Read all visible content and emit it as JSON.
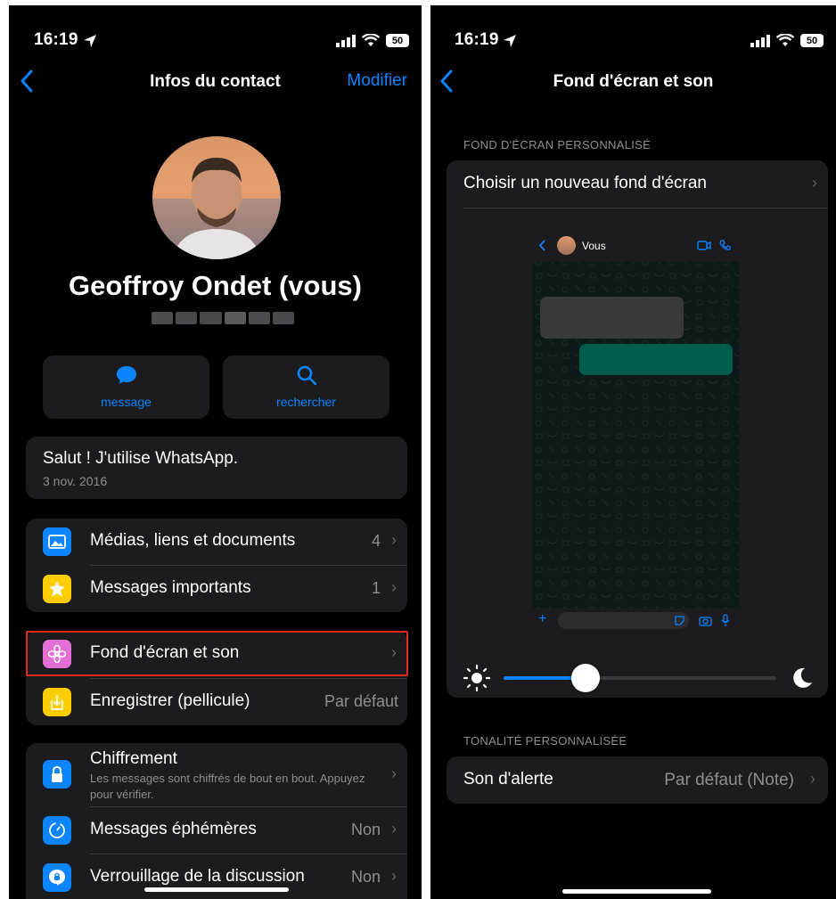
{
  "left": {
    "status": {
      "time": "16:19",
      "battery": "50"
    },
    "nav": {
      "title": "Infos du contact",
      "edit": "Modifier"
    },
    "profile": {
      "name": "Geoffroy Ondet (vous)"
    },
    "actions": [
      {
        "label": "message",
        "icon": "chat-bubble-icon"
      },
      {
        "label": "rechercher",
        "icon": "search-icon"
      }
    ],
    "about": {
      "text": "Salut ! J'utilise WhatsApp.",
      "date": "3 nov. 2016"
    },
    "group1": [
      {
        "label": "Médias, liens et documents",
        "value": "4",
        "icon": "photo-icon",
        "color": "#0a84ff"
      },
      {
        "label": "Messages importants",
        "value": "1",
        "icon": "star-icon",
        "color": "#ffcc00"
      }
    ],
    "group2": [
      {
        "label": "Fond d'écran et son",
        "value": "",
        "icon": "flower-icon",
        "color": "#e36fd4"
      },
      {
        "label": "Enregistrer (pellicule)",
        "value": "Par défaut",
        "icon": "save-icon",
        "color": "#ffcc00"
      }
    ],
    "group3": [
      {
        "label": "Chiffrement",
        "sub": "Les messages sont chiffrés de bout en bout. Appuyez pour vérifier.",
        "icon": "lock-icon",
        "color": "#0a84ff"
      },
      {
        "label": "Messages éphémères",
        "value": "Non",
        "icon": "timer-icon",
        "color": "#0a84ff"
      },
      {
        "label": "Verrouillage de la discussion",
        "value": "Non",
        "icon": "chat-lock-icon",
        "color": "#0a84ff"
      }
    ],
    "highlight_color": "#e0281e"
  },
  "right": {
    "status": {
      "time": "16:19",
      "battery": "50"
    },
    "nav": {
      "title": "Fond d'écran et son"
    },
    "wallpaper_section": "FOND D'ÉCRAN PERSONNALISÉ",
    "choose_label": "Choisir un nouveau fond d'écran",
    "preview": {
      "contact": "Vous"
    },
    "brightness": 0.3,
    "tone_section": "TONALITÉ PERSONNALISÉE",
    "alert": {
      "label": "Son d'alerte",
      "value": "Par défaut (Note)"
    }
  },
  "colors": {
    "accent": "#0a84ff",
    "card": "#1c1c1e",
    "background": "#000000"
  }
}
